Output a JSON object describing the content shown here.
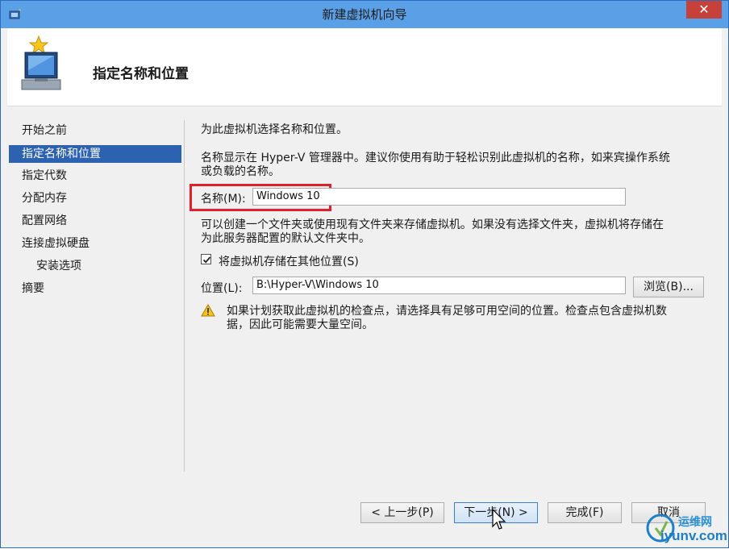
{
  "window": {
    "title": "新建虚拟机向导",
    "close_label": "✕"
  },
  "header": {
    "heading": "指定名称和位置"
  },
  "nav": {
    "items": [
      {
        "label": "开始之前",
        "active": false,
        "sub": false
      },
      {
        "label": "指定名称和位置",
        "active": true,
        "sub": false
      },
      {
        "label": "指定代数",
        "active": false,
        "sub": false
      },
      {
        "label": "分配内存",
        "active": false,
        "sub": false
      },
      {
        "label": "配置网络",
        "active": false,
        "sub": false
      },
      {
        "label": "连接虚拟硬盘",
        "active": false,
        "sub": false
      },
      {
        "label": "安装选项",
        "active": false,
        "sub": true
      },
      {
        "label": "摘要",
        "active": false,
        "sub": false
      }
    ]
  },
  "content": {
    "intro": "为此虚拟机选择名称和位置。",
    "name_desc_line1": "名称显示在 Hyper-V 管理器中。建议你使用有助于轻松识别此虚拟机的名称，如来宾操作系统",
    "name_desc_line2": "或负载的名称。",
    "name_label": "名称(M):",
    "name_value": "Windows 10",
    "folder_desc_line1": "可以创建一个文件夹或使用现有文件夹来存储虚拟机。如果没有选择文件夹，虚拟机将存储在",
    "folder_desc_line2": "为此服务器配置的默认文件夹中。",
    "store_elsewhere_label": "将虚拟机存储在其他位置(S)",
    "store_elsewhere_checked": true,
    "location_label": "位置(L):",
    "location_value": "B:\\Hyper-V\\Windows 10",
    "browse_label": "浏览(B)...",
    "warning_line1": "如果计划获取此虚拟机的检查点，请选择具有足够可用空间的位置。检查点包含虚拟机数",
    "warning_line2": "据，因此可能需要大量空间。"
  },
  "footer": {
    "prev_label": "< 上一步(P)",
    "next_label": "下一步(N) >",
    "finish_label": "完成(F)",
    "cancel_label": "取消"
  },
  "watermark": {
    "line1": "运维网",
    "line2": "iyunv.com"
  },
  "colors": {
    "titlebar": "#5aa0e6",
    "nav_active": "#2d62b0",
    "highlight_box": "#e0202a",
    "close": "#c7403a"
  }
}
